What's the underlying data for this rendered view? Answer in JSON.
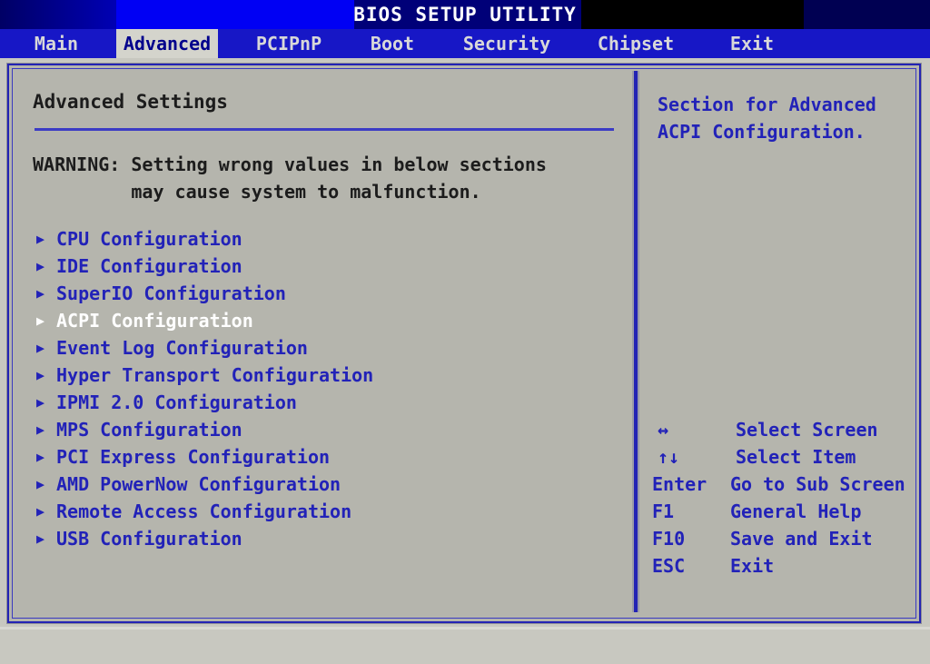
{
  "titlebar": {
    "title": "BIOS SETUP UTILITY"
  },
  "tabs": [
    {
      "label": "Main",
      "active": false
    },
    {
      "label": "Advanced",
      "active": true
    },
    {
      "label": "PCIPnP",
      "active": false
    },
    {
      "label": "Boot",
      "active": false
    },
    {
      "label": "Security",
      "active": false
    },
    {
      "label": "Chipset",
      "active": false
    },
    {
      "label": "Exit",
      "active": false
    }
  ],
  "left": {
    "heading": "Advanced Settings",
    "warning_line1": "WARNING: Setting wrong values in below sections",
    "warning_line2": "         may cause system to malfunction.",
    "arrow_glyph": "▶",
    "items": [
      {
        "label": "CPU Configuration",
        "selected": false
      },
      {
        "label": "IDE Configuration",
        "selected": false
      },
      {
        "label": "SuperIO Configuration",
        "selected": false
      },
      {
        "label": "ACPI Configuration",
        "selected": true
      },
      {
        "label": "Event Log Configuration",
        "selected": false
      },
      {
        "label": "Hyper Transport Configuration",
        "selected": false
      },
      {
        "label": "IPMI 2.0 Configuration",
        "selected": false
      },
      {
        "label": "MPS Configuration",
        "selected": false
      },
      {
        "label": "PCI Express Configuration",
        "selected": false
      },
      {
        "label": "AMD PowerNow Configuration",
        "selected": false
      },
      {
        "label": "Remote Access Configuration",
        "selected": false
      },
      {
        "label": "USB Configuration",
        "selected": false
      }
    ]
  },
  "right": {
    "help_line1": "Section for Advanced",
    "help_line2": "ACPI Configuration.",
    "keys": [
      {
        "key": "↔",
        "desc": "Select Screen"
      },
      {
        "key": "↑↓",
        "desc": "Select Item"
      },
      {
        "key": "Enter",
        "desc": "Go to Sub Screen"
      },
      {
        "key": "F1",
        "desc": "General Help"
      },
      {
        "key": "F10",
        "desc": "Save and Exit"
      },
      {
        "key": "ESC",
        "desc": "Exit"
      }
    ]
  },
  "colors": {
    "screen_bg": "#c8c8c0",
    "panel_bg": "#b5b5ad",
    "border_blue": "#2323b4",
    "text_blue": "#2222b8",
    "text_dark": "#1c1c1c",
    "selected_white": "#ffffff",
    "tabbar_blue": "#1717c6",
    "tab_active_bg": "#d4d4cc",
    "title_blue": "#0000f4"
  }
}
